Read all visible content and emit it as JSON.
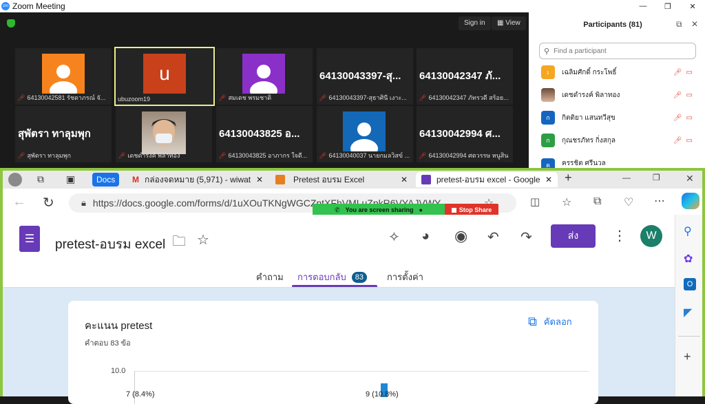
{
  "zoom": {
    "window_title": "Zoom Meeting",
    "logo_text": "zm",
    "sign_in": "Sign in",
    "view": "View",
    "tiles": [
      {
        "name": "64130042581 รัชดาภรณ์ จั...",
        "avatar_color": "#f7831e",
        "type": "person"
      },
      {
        "name": "ubuzoom19",
        "avatar_letter": "u",
        "avatar_color": "#c8411b",
        "type": "letter"
      },
      {
        "name": "สมเดช พรมชาติ",
        "avatar_color": "#8b2fc9",
        "type": "person"
      },
      {
        "name": "64130043397-สุธาศินี เงาะ...",
        "big": "64130043397-สุ...",
        "type": "big"
      },
      {
        "name": "64130042347 ภัทรวดี สร้อย...",
        "big": "64130042347 ภั...",
        "type": "big"
      },
      {
        "name": "สุพัตรา ทาลุมพุก",
        "big": "สุพัตรา ทาลุมพุก",
        "type": "big"
      },
      {
        "name": "เดชดำรงค์ พิลาทอง",
        "type": "photo"
      },
      {
        "name": "64130043825 อาภากร ใจดี...",
        "big": "64130043825 อ...",
        "type": "big"
      },
      {
        "name": "64130040037 นายกมลวิสข์ ...",
        "avatar_color": "#1468b8",
        "type": "person"
      },
      {
        "name": "64130042994 ศตวรรษ หนูสิน",
        "big": "64130042994 ศ...",
        "type": "big"
      }
    ]
  },
  "participants": {
    "title": "Participants (81)",
    "search_placeholder": "Find a participant",
    "items": [
      {
        "letter": "เ",
        "name": "เฉลิมศักดิ์ กระโพธิ์",
        "color": "#f5a623"
      },
      {
        "letter": "",
        "name": "เดชดำรงค์ พิลาทอง",
        "color": "#a0522d"
      },
      {
        "letter": "ก",
        "name": "กิตติยา แสนทวีสุข",
        "color": "#1565c0"
      },
      {
        "letter": "ก",
        "name": "กุณชรภัทร กิ่งสกุล",
        "color": "#2e9e44"
      },
      {
        "letter": "ค",
        "name": "ครรชิต ศรีนวล",
        "color": "#1565c0"
      }
    ]
  },
  "browser": {
    "docs_badge": "Docs",
    "tabs": [
      {
        "label": "กล่องจดหมาย (5,971) - wiwat"
      },
      {
        "label": "Pretest อบรม Excel"
      },
      {
        "label": "pretest-อบรม excel - Google"
      }
    ],
    "url": "https://docs.google.com/forms/d/1uXOuTKNgWGCZntXFhVMLuZpkR6VYAJVWY",
    "share_banner": "You are screen sharing",
    "stop_share": "Stop Share"
  },
  "form": {
    "title": "pretest-อบรม excel",
    "send": "ส่ง",
    "avatar": "W",
    "tabs": [
      {
        "label": "คำถาม"
      },
      {
        "label": "การตอบกลับ",
        "badge": "83"
      },
      {
        "label": "การตั้งค่า"
      }
    ],
    "card_title": "คะแนน pretest",
    "card_sub": "คำตอบ 83 ข้อ",
    "copy": "คัดลอก",
    "axis_top": "10.0",
    "label_left": "7 (8.4%)",
    "label_mid": "9 (10.8%)"
  }
}
